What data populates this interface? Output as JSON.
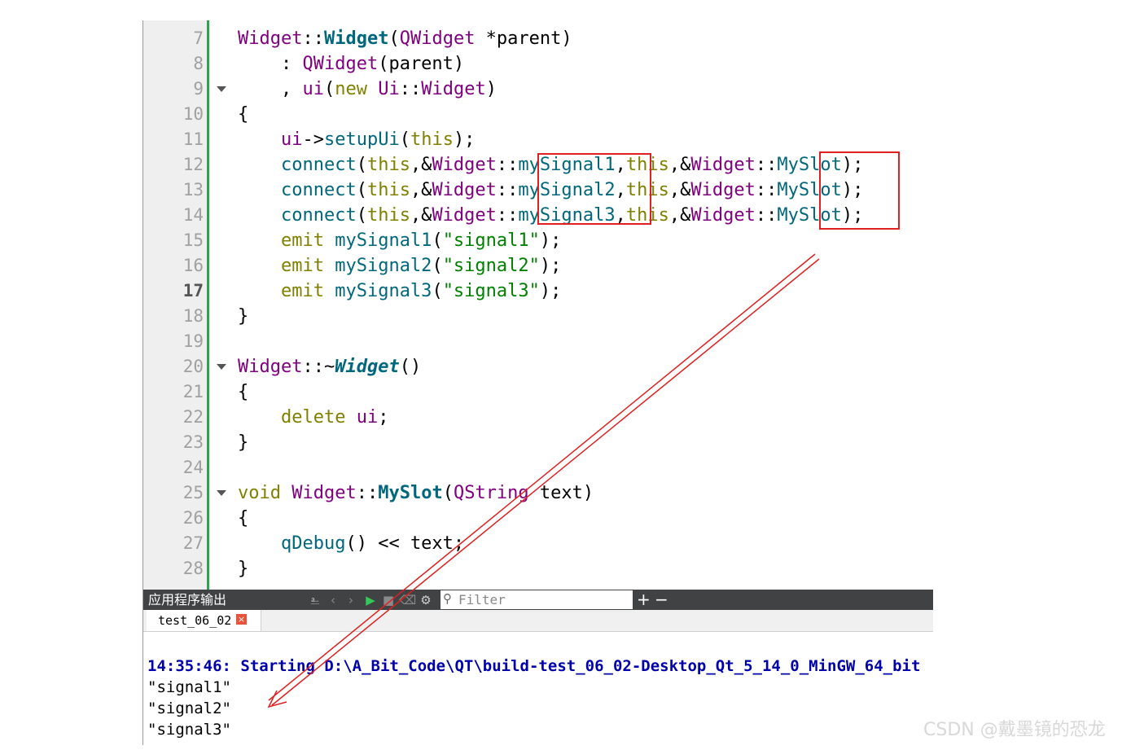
{
  "editor": {
    "current_line": 17,
    "lines": [
      {
        "n": "7",
        "fold": false,
        "tokens": [
          [
            "t-type",
            "Widget"
          ],
          [
            "t-op",
            "::"
          ],
          [
            "t-funcb",
            "Widget"
          ],
          [
            "t-op",
            "("
          ],
          [
            "t-type",
            "QWidget"
          ],
          [
            "t-op",
            " *parent)"
          ]
        ]
      },
      {
        "n": "8",
        "fold": false,
        "tokens": [
          [
            "t-op",
            "    : "
          ],
          [
            "t-type",
            "QWidget"
          ],
          [
            "t-op",
            "(parent)"
          ]
        ]
      },
      {
        "n": "9",
        "fold": true,
        "tokens": [
          [
            "t-op",
            "    , "
          ],
          [
            "t-type",
            "ui"
          ],
          [
            "t-op",
            "("
          ],
          [
            "t-kw",
            "new "
          ],
          [
            "t-type",
            "Ui"
          ],
          [
            "t-op",
            "::"
          ],
          [
            "t-type",
            "Widget"
          ],
          [
            "t-op",
            ")"
          ]
        ]
      },
      {
        "n": "10",
        "fold": false,
        "tokens": [
          [
            "t-op",
            "{"
          ]
        ]
      },
      {
        "n": "11",
        "fold": false,
        "tokens": [
          [
            "t-op",
            "    "
          ],
          [
            "t-type",
            "ui"
          ],
          [
            "t-op",
            "->"
          ],
          [
            "t-func",
            "setupUi"
          ],
          [
            "t-op",
            "("
          ],
          [
            "t-kw",
            "this"
          ],
          [
            "t-op",
            ");"
          ]
        ]
      },
      {
        "n": "12",
        "fold": false,
        "tokens": [
          [
            "t-op",
            "    "
          ],
          [
            "t-func",
            "connect"
          ],
          [
            "t-op",
            "("
          ],
          [
            "t-kw",
            "this"
          ],
          [
            "t-op",
            ",&"
          ],
          [
            "t-type",
            "Widget"
          ],
          [
            "t-op",
            "::"
          ],
          [
            "t-func",
            "mySignal1"
          ],
          [
            "t-op",
            ","
          ],
          [
            "t-kw",
            "this"
          ],
          [
            "t-op",
            ",&"
          ],
          [
            "t-type",
            "Widget"
          ],
          [
            "t-op",
            "::"
          ],
          [
            "t-func",
            "MySlot"
          ],
          [
            "t-op",
            ");"
          ]
        ]
      },
      {
        "n": "13",
        "fold": false,
        "tokens": [
          [
            "t-op",
            "    "
          ],
          [
            "t-func",
            "connect"
          ],
          [
            "t-op",
            "("
          ],
          [
            "t-kw",
            "this"
          ],
          [
            "t-op",
            ",&"
          ],
          [
            "t-type",
            "Widget"
          ],
          [
            "t-op",
            "::"
          ],
          [
            "t-func",
            "mySignal2"
          ],
          [
            "t-op",
            ","
          ],
          [
            "t-kw",
            "this"
          ],
          [
            "t-op",
            ",&"
          ],
          [
            "t-type",
            "Widget"
          ],
          [
            "t-op",
            "::"
          ],
          [
            "t-func",
            "MySlot"
          ],
          [
            "t-op",
            ");"
          ]
        ]
      },
      {
        "n": "14",
        "fold": false,
        "tokens": [
          [
            "t-op",
            "    "
          ],
          [
            "t-func",
            "connect"
          ],
          [
            "t-op",
            "("
          ],
          [
            "t-kw",
            "this"
          ],
          [
            "t-op",
            ",&"
          ],
          [
            "t-type",
            "Widget"
          ],
          [
            "t-op",
            "::"
          ],
          [
            "t-func",
            "mySignal3"
          ],
          [
            "t-op",
            ","
          ],
          [
            "t-kw",
            "this"
          ],
          [
            "t-op",
            ",&"
          ],
          [
            "t-type",
            "Widget"
          ],
          [
            "t-op",
            "::"
          ],
          [
            "t-func",
            "MySlot"
          ],
          [
            "t-op",
            ");"
          ]
        ]
      },
      {
        "n": "15",
        "fold": false,
        "tokens": [
          [
            "t-op",
            "    "
          ],
          [
            "t-kw",
            "emit "
          ],
          [
            "t-func",
            "mySignal1"
          ],
          [
            "t-op",
            "("
          ],
          [
            "t-str",
            "\"signal1\""
          ],
          [
            "t-op",
            ");"
          ]
        ]
      },
      {
        "n": "16",
        "fold": false,
        "tokens": [
          [
            "t-op",
            "    "
          ],
          [
            "t-kw",
            "emit "
          ],
          [
            "t-func",
            "mySignal2"
          ],
          [
            "t-op",
            "("
          ],
          [
            "t-str",
            "\"signal2\""
          ],
          [
            "t-op",
            ");"
          ]
        ]
      },
      {
        "n": "17",
        "fold": false,
        "tokens": [
          [
            "t-op",
            "    "
          ],
          [
            "t-kw",
            "emit "
          ],
          [
            "t-func",
            "mySignal3"
          ],
          [
            "t-op",
            "("
          ],
          [
            "t-str",
            "\"signal3\""
          ],
          [
            "t-op",
            ");"
          ]
        ]
      },
      {
        "n": "18",
        "fold": false,
        "tokens": [
          [
            "t-op",
            "}"
          ]
        ]
      },
      {
        "n": "19",
        "fold": false,
        "tokens": []
      },
      {
        "n": "20",
        "fold": true,
        "tokens": [
          [
            "t-type",
            "Widget"
          ],
          [
            "t-op",
            "::~"
          ],
          [
            "t-funci",
            "Widget"
          ],
          [
            "t-op",
            "()"
          ]
        ]
      },
      {
        "n": "21",
        "fold": false,
        "tokens": [
          [
            "t-op",
            "{"
          ]
        ]
      },
      {
        "n": "22",
        "fold": false,
        "tokens": [
          [
            "t-op",
            "    "
          ],
          [
            "t-kw",
            "delete "
          ],
          [
            "t-type",
            "ui"
          ],
          [
            "t-op",
            ";"
          ]
        ]
      },
      {
        "n": "23",
        "fold": false,
        "tokens": [
          [
            "t-op",
            "}"
          ]
        ]
      },
      {
        "n": "24",
        "fold": false,
        "tokens": []
      },
      {
        "n": "25",
        "fold": true,
        "tokens": [
          [
            "t-kw",
            "void "
          ],
          [
            "t-type",
            "Widget"
          ],
          [
            "t-op",
            "::"
          ],
          [
            "t-funcb",
            "MySlot"
          ],
          [
            "t-op",
            "("
          ],
          [
            "t-type",
            "QString"
          ],
          [
            "t-op",
            " text)"
          ]
        ]
      },
      {
        "n": "26",
        "fold": false,
        "tokens": [
          [
            "t-op",
            "{"
          ]
        ]
      },
      {
        "n": "27",
        "fold": false,
        "tokens": [
          [
            "t-op",
            "    "
          ],
          [
            "t-func",
            "qDebug"
          ],
          [
            "t-op",
            "() << text;"
          ]
        ]
      },
      {
        "n": "28",
        "fold": false,
        "tokens": [
          [
            "t-op",
            "}"
          ]
        ]
      }
    ]
  },
  "output_pane": {
    "title": "应用程序输出",
    "filter_placeholder": "Filter",
    "add_label": "+",
    "remove_label": "−",
    "tab_label": "test_06_02",
    "tab_close_label": "×",
    "lines": [
      {
        "cls": "out-start",
        "text": "14:35:46: Starting D:\\A_Bit_Code\\QT\\build-test_06_02-Desktop_Qt_5_14_0_MinGW_64_bit"
      },
      {
        "cls": "out-text",
        "text": "\"signal1\""
      },
      {
        "cls": "out-text",
        "text": "\"signal2\""
      },
      {
        "cls": "out-text",
        "text": "\"signal3\""
      }
    ]
  },
  "icons": {
    "toolbar": [
      "attach-icon",
      "prev-icon",
      "next-icon",
      "run-icon",
      "stop-icon",
      "clean-icon",
      "settings-icon"
    ]
  },
  "colors": {
    "annotation": "#e02020",
    "toolbar_bg": "#404244",
    "gutter_bg": "#efefef",
    "run_green": "#34c759"
  },
  "watermark": "CSDN @戴墨镜的恐龙"
}
